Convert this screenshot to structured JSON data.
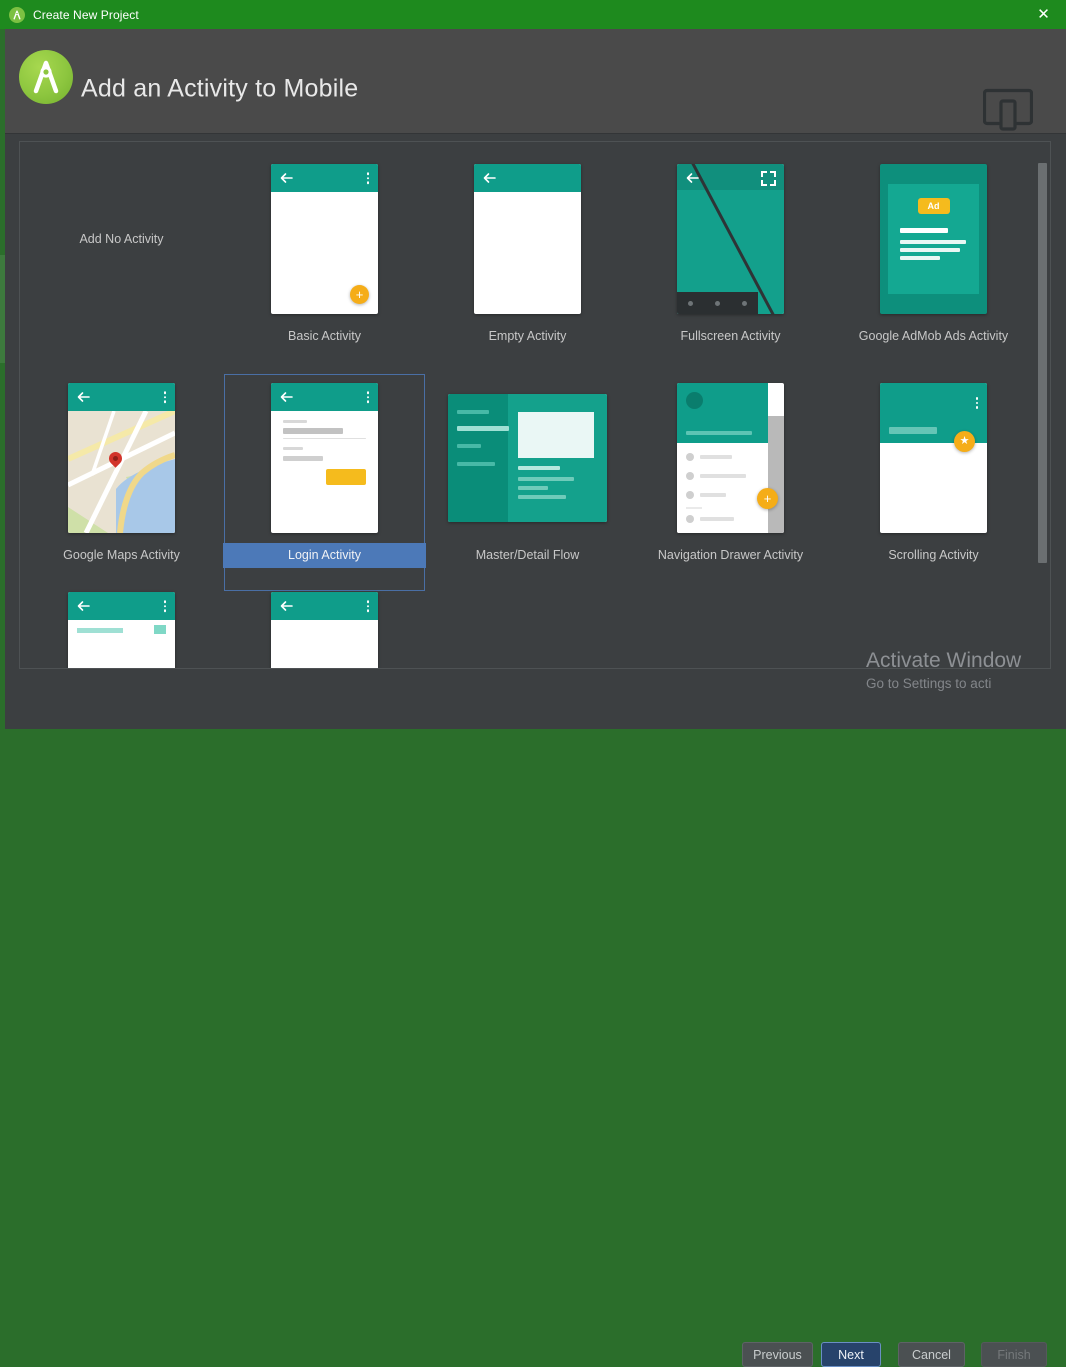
{
  "window": {
    "title": "Create New Project",
    "close_label": "✕",
    "logo_icon": "android-studio-logo-icon"
  },
  "header": {
    "title": "Add an Activity to Mobile",
    "device_icon": "tablet-and-phone-icon"
  },
  "colors": {
    "titlebar_green": "#1e8a1e",
    "dialog_bg": "#3c3f41",
    "header_bg": "#4a4a4a",
    "teal": "#0f9d8a",
    "accent_orange": "#f5ad18",
    "selection_blue": "#4c79b8",
    "selection_border": "#4a6fa5",
    "primary_button_blue": "#27436b"
  },
  "templates": [
    {
      "label": "Add No Activity",
      "type": "none",
      "selected": false
    },
    {
      "label": "Basic Activity",
      "type": "basic",
      "selected": false
    },
    {
      "label": "Empty Activity",
      "type": "empty",
      "selected": false
    },
    {
      "label": "Fullscreen Activity",
      "type": "fullscreen",
      "selected": false
    },
    {
      "label": "Google AdMob Ads Activity",
      "type": "admob",
      "selected": false,
      "badge": "Ad"
    },
    {
      "label": "Google Maps Activity",
      "type": "maps",
      "selected": false
    },
    {
      "label": "Login Activity",
      "type": "login",
      "selected": true
    },
    {
      "label": "Master/Detail Flow",
      "type": "masterdetail",
      "selected": false
    },
    {
      "label": "Navigation Drawer Activity",
      "type": "navdrawer",
      "selected": false
    },
    {
      "label": "Scrolling Activity",
      "type": "scrolling",
      "selected": false
    },
    {
      "label": "",
      "type": "clipped",
      "selected": false
    },
    {
      "label": "",
      "type": "clipped",
      "selected": false
    }
  ],
  "scrollbar": {
    "orientation": "vertical",
    "thumb_top_pct": 4,
    "thumb_height_pct": 76
  },
  "watermark": {
    "line1": "Activate Window",
    "line2": "Go to Settings to acti"
  },
  "footer": {
    "previous_label": "Previous",
    "next_label": "Next",
    "cancel_label": "Cancel",
    "finish_label": "Finish"
  }
}
